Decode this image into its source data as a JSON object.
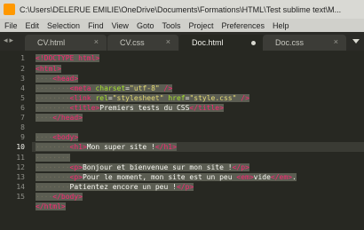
{
  "window": {
    "title": "C:\\Users\\DELERUE EMILIE\\OneDrive\\Documents\\Formations\\HTML\\Test sublime text\\M..."
  },
  "menu": [
    "File",
    "Edit",
    "Selection",
    "Find",
    "View",
    "Goto",
    "Tools",
    "Project",
    "Preferences",
    "Help"
  ],
  "tabs": [
    {
      "label": "CV.html",
      "mark": "×"
    },
    {
      "label": "CV.css",
      "mark": "×"
    },
    {
      "label": "Doc.html",
      "mark": ""
    },
    {
      "label": "Doc.css",
      "mark": "×"
    }
  ],
  "editor": {
    "line_numbers": [
      "1",
      "2",
      "3",
      "4",
      "5",
      "6",
      "7",
      "8",
      "9",
      "10",
      "11",
      "12",
      "13",
      "14",
      "15"
    ],
    "current_line": "10",
    "lines": [
      {
        "tokens": [
          {
            "c": "t",
            "v": "<!DOCTYPE html>"
          }
        ]
      },
      {
        "tokens": [
          {
            "c": "t",
            "v": "<html>"
          }
        ]
      },
      {
        "tokens": [
          {
            "c": "ws",
            "v": "····"
          },
          {
            "c": "t",
            "v": "<head>"
          }
        ]
      },
      {
        "tokens": [
          {
            "c": "ws",
            "v": "········"
          },
          {
            "c": "t",
            "v": "<meta"
          },
          {
            "c": "p",
            "v": " "
          },
          {
            "c": "a",
            "v": "charset"
          },
          {
            "c": "p",
            "v": "="
          },
          {
            "c": "s",
            "v": "\"utf-8\""
          },
          {
            "c": "p",
            "v": " "
          },
          {
            "c": "t",
            "v": "/>"
          }
        ]
      },
      {
        "tokens": [
          {
            "c": "ws",
            "v": "········"
          },
          {
            "c": "t",
            "v": "<link"
          },
          {
            "c": "p",
            "v": " "
          },
          {
            "c": "a",
            "v": "rel"
          },
          {
            "c": "p",
            "v": "="
          },
          {
            "c": "s",
            "v": "\"stylesheet\""
          },
          {
            "c": "p",
            "v": " "
          },
          {
            "c": "a",
            "v": "href"
          },
          {
            "c": "p",
            "v": "="
          },
          {
            "c": "s",
            "v": "\"style.css\""
          },
          {
            "c": "p",
            "v": " "
          },
          {
            "c": "t",
            "v": "/>"
          }
        ]
      },
      {
        "tokens": [
          {
            "c": "ws",
            "v": "········"
          },
          {
            "c": "t",
            "v": "<title>"
          },
          {
            "c": "p",
            "v": "Premiers tests du CSS"
          },
          {
            "c": "t",
            "v": "</title>"
          }
        ]
      },
      {
        "tokens": [
          {
            "c": "ws",
            "v": "····"
          },
          {
            "c": "t",
            "v": "</head>"
          }
        ]
      },
      {
        "tokens": []
      },
      {
        "tokens": [
          {
            "c": "ws",
            "v": "····"
          },
          {
            "c": "t",
            "v": "<body>"
          }
        ]
      },
      {
        "tokens": [
          {
            "c": "ws",
            "v": "········"
          },
          {
            "c": "t",
            "v": "<h1>"
          },
          {
            "c": "p",
            "v": "Mon super site !"
          },
          {
            "c": "t",
            "v": "</h1>"
          }
        ]
      },
      {
        "tokens": [
          {
            "c": "ws",
            "v": "········"
          }
        ]
      },
      {
        "tokens": [
          {
            "c": "ws",
            "v": "········"
          },
          {
            "c": "t",
            "v": "<p>"
          },
          {
            "c": "p",
            "v": "Bonjour et bienvenue sur mon site !"
          },
          {
            "c": "t",
            "v": "</p>"
          }
        ]
      },
      {
        "tokens": [
          {
            "c": "ws",
            "v": "········"
          },
          {
            "c": "t",
            "v": "<p>"
          },
          {
            "c": "p",
            "v": "Pour le moment, mon site est un peu "
          },
          {
            "c": "t",
            "v": "<em>"
          },
          {
            "c": "p",
            "v": "vide"
          },
          {
            "c": "t",
            "v": "</em>"
          },
          {
            "c": "p",
            "v": "."
          }
        ]
      },
      {
        "tokens": [
          {
            "c": "ws",
            "v": "········"
          },
          {
            "c": "p",
            "v": "Patientez encore un peu !"
          },
          {
            "c": "t",
            "v": "</p>"
          }
        ]
      },
      {
        "tokens": [
          {
            "c": "ws",
            "v": "····"
          },
          {
            "c": "t",
            "v": "</body>"
          }
        ]
      },
      {
        "tokens": [
          {
            "c": "t",
            "v": "</html>"
          }
        ]
      }
    ]
  }
}
